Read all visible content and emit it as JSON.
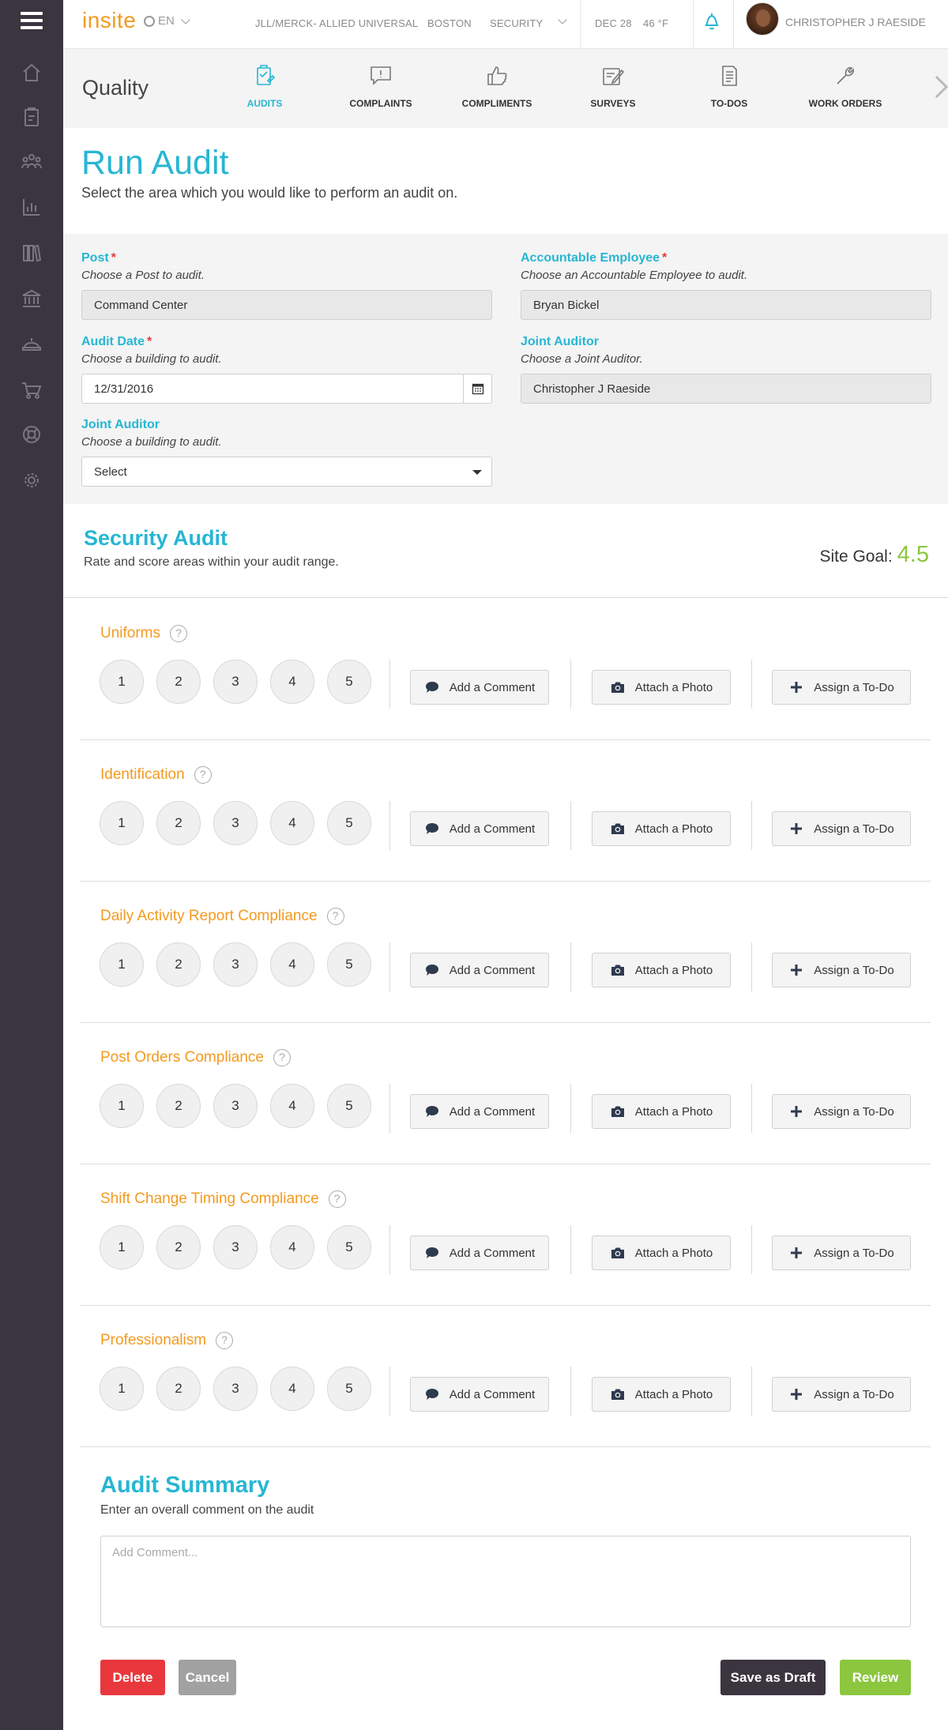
{
  "app": {
    "logo": "insite",
    "language": "EN",
    "client": "JLL/MERCK- ALLIED UNIVERSAL",
    "city": "BOSTON",
    "department": "SECURITY",
    "date": "DEC 28",
    "temperature": "46 °F",
    "user_name": "CHRISTOPHER J RAESIDE"
  },
  "sidebar": {
    "items": [
      "home-icon",
      "audit-clipboard-icon",
      "people-icon",
      "bar-chart-icon",
      "library-icon",
      "bank-icon",
      "hard-hat-icon",
      "cart-icon",
      "lifebuoy-icon",
      "settings-icon"
    ]
  },
  "module": {
    "title": "Quality",
    "tabs": [
      {
        "label": "AUDITS",
        "icon": "clipboard-check-icon",
        "active": true
      },
      {
        "label": "COMPLAINTS",
        "icon": "speech-bubble-icon",
        "active": false
      },
      {
        "label": "COMPLIMENTS",
        "icon": "thumbs-up-icon",
        "active": false
      },
      {
        "label": "SURVEYS",
        "icon": "survey-pencil-icon",
        "active": false
      },
      {
        "label": "TO-DOs",
        "icon": "document-list-icon",
        "active": false
      },
      {
        "label": "WORK ORDERS",
        "icon": "wrench-icon",
        "active": false
      }
    ]
  },
  "page": {
    "title": "Run Audit",
    "subtitle": "Select the area which you would like to perform an audit on."
  },
  "form": {
    "post": {
      "label": "Post",
      "required": "*",
      "hint": "Choose a Post to audit.",
      "value": "Command Center"
    },
    "accountable_employee": {
      "label": "Accountable Employee",
      "required": "*",
      "hint": "Choose an Accountable Employee to audit.",
      "value": "Bryan Bickel"
    },
    "audit_date": {
      "label": "Audit Date",
      "required": "*",
      "hint": "Choose a building to audit.",
      "value": "12/31/2016"
    },
    "joint_auditor_right": {
      "label": "Joint Auditor",
      "hint": "Choose a Joint Auditor.",
      "value": "Christopher J Raeside"
    },
    "joint_auditor_left": {
      "label": "Joint Auditor",
      "hint": "Choose a building to audit.",
      "value": "Select"
    }
  },
  "audit": {
    "title": "Security Audit",
    "subtitle": "Rate and score areas within your audit range.",
    "site_goal_label": "Site Goal:",
    "site_goal_value": "4.5",
    "help_glyph": "?",
    "scores": [
      "1",
      "2",
      "3",
      "4",
      "5"
    ],
    "actions": {
      "comment": "Add a Comment",
      "photo": "Attach a Photo",
      "todo": "Assign a To-Do"
    },
    "categories": [
      "Uniforms",
      "Identification",
      "Daily Activity Report Compliance",
      "Post Orders Compliance",
      "Shift Change Timing Compliance",
      "Professionalism"
    ]
  },
  "summary": {
    "title": "Audit Summary",
    "subtitle": "Enter an overall comment on the audit",
    "placeholder": "Add Comment..."
  },
  "buttons": {
    "delete": "Delete",
    "cancel": "Cancel",
    "save_draft": "Save as Draft",
    "review": "Review"
  },
  "colors": {
    "accent": "#27b6d3",
    "orange": "#f39a1f",
    "green": "#8cc63f",
    "red": "#e8383d",
    "sidebar": "#3b3540"
  }
}
